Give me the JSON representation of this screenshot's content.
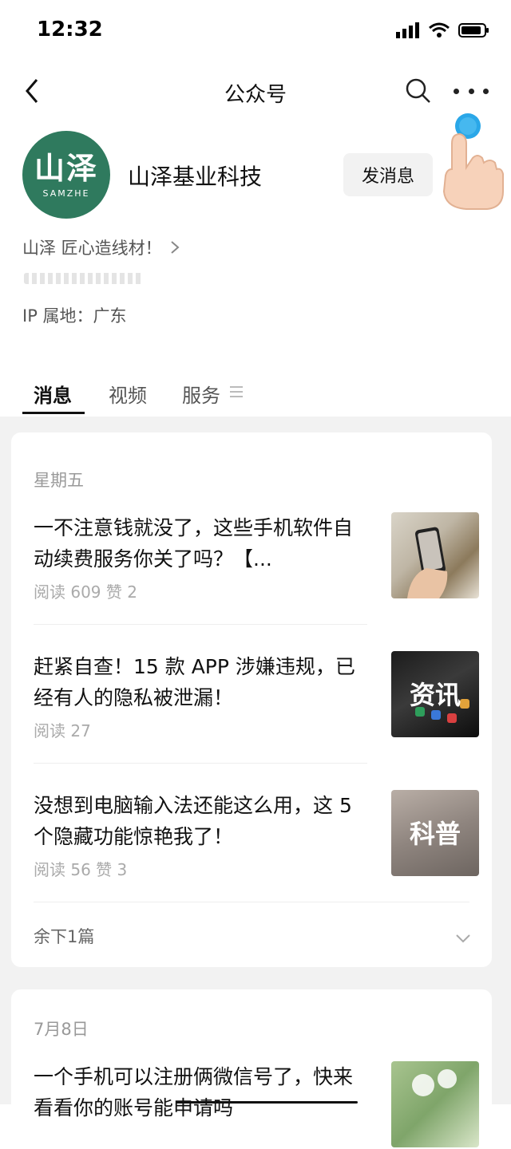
{
  "status": {
    "time": "12:32"
  },
  "nav": {
    "title": "公众号"
  },
  "profile": {
    "avatar_main": "山泽",
    "avatar_sub": "SAMZHE",
    "name": "山泽基业科技",
    "send_button": "发消息",
    "intro": "山泽 匠心造线材！",
    "ip_location": "IP 属地：广东"
  },
  "tabs": [
    {
      "label": "消息"
    },
    {
      "label": "视频"
    },
    {
      "label": "服务"
    }
  ],
  "feed": {
    "group1": {
      "date": "星期五",
      "articles": [
        {
          "title": "一不注意钱就没了，这些手机软件自动续费服务你关了吗？【...",
          "stats": "阅读 609  赞 2"
        },
        {
          "title": "赶紧自查！15 款 APP 涉嫌违规，已经有人的隐私被泄漏！",
          "stats": "阅读 27",
          "thumb_label": "资讯"
        },
        {
          "title": "没想到电脑输入法还能这么用，这 5 个隐藏功能惊艳我了！",
          "stats": "阅读 56  赞 3",
          "thumb_label": "科普"
        }
      ],
      "more": "余下1篇"
    },
    "group2": {
      "date": "7月8日",
      "articles": [
        {
          "title": "一个手机可以注册俩微信号了，快来看看你的账号能申请吗"
        }
      ]
    }
  },
  "colors": {
    "brand_green": "#2f7a5e",
    "tap_blue": "#2aa7e8"
  }
}
